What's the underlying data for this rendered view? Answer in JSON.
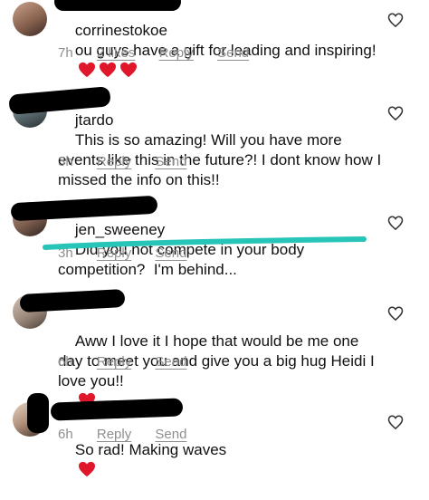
{
  "comments": [
    {
      "username": "corrinestokoe",
      "text": "ou guys have a gift for leading and inspiring!",
      "hearts": 3,
      "time": "7h",
      "likes": "2 likes",
      "reply": "Reply",
      "send": "Send"
    },
    {
      "username": "jtardo",
      "text": "This is so amazing! Will you have more events like this in the future?! I dont know how I missed the info on this!!",
      "time": "3h",
      "reply": "Reply",
      "send": "Send"
    },
    {
      "username": "jen_sweeney",
      "text": "Did you not compete in your body competition?  I'm behind...",
      "time": "3h",
      "reply": "Reply",
      "send": "Send"
    },
    {
      "username": "",
      "text": "Aww I love it I hope that would be me one day to meet you and give you a big hug Heidi I love you!!",
      "hearts": 1,
      "time": "6h",
      "reply": "Reply",
      "send": "Send"
    },
    {
      "username": "",
      "text": "So rad! Making waves",
      "hearts": 1,
      "time": "6h",
      "reply": "Reply",
      "send": "Send"
    }
  ],
  "colors": {
    "meta_gray": "#8e8e8e",
    "emoji_heart": "#e0162b",
    "annotation_teal": "#27c4b8"
  },
  "icons": [
    "like-heart-icon",
    "heart-emoji-icon",
    "avatar"
  ]
}
